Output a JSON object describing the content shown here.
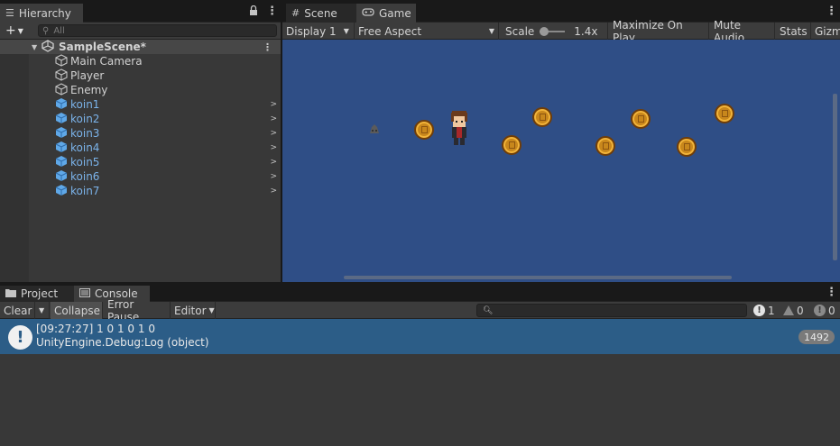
{
  "hierarchy": {
    "tab_label": "Hierarchy",
    "search_placeholder": "All",
    "scene_name": "SampleScene*",
    "objects": [
      "Main Camera",
      "Player",
      "Enemy"
    ],
    "prefabs": [
      "koin1",
      "koin2",
      "koin3",
      "koin4",
      "koin5",
      "koin6",
      "koin7"
    ]
  },
  "game": {
    "tabs": [
      "Scene",
      "Game"
    ],
    "active_tab": "Game",
    "display": "Display 1",
    "aspect": "Free Aspect",
    "scale_label": "Scale",
    "scale_value": "1.4x",
    "maximize_on_play": "Maximize On Play",
    "mute_audio": "Mute Audio",
    "stats": "Stats",
    "gizmos": "Gizm",
    "background_color": "#2f4e86"
  },
  "console": {
    "tabs": [
      "Project",
      "Console"
    ],
    "active_tab": "Console",
    "clear": "Clear",
    "collapse": "Collapse",
    "error_pause": "Error Pause",
    "editor": "Editor",
    "counts": {
      "log": "1",
      "warning": "0",
      "error": "0"
    },
    "entry": {
      "line1": "[09:27:27] 1 0 1 0 1 0",
      "line2": "UnityEngine.Debug:Log (object)",
      "count": "1492"
    }
  }
}
